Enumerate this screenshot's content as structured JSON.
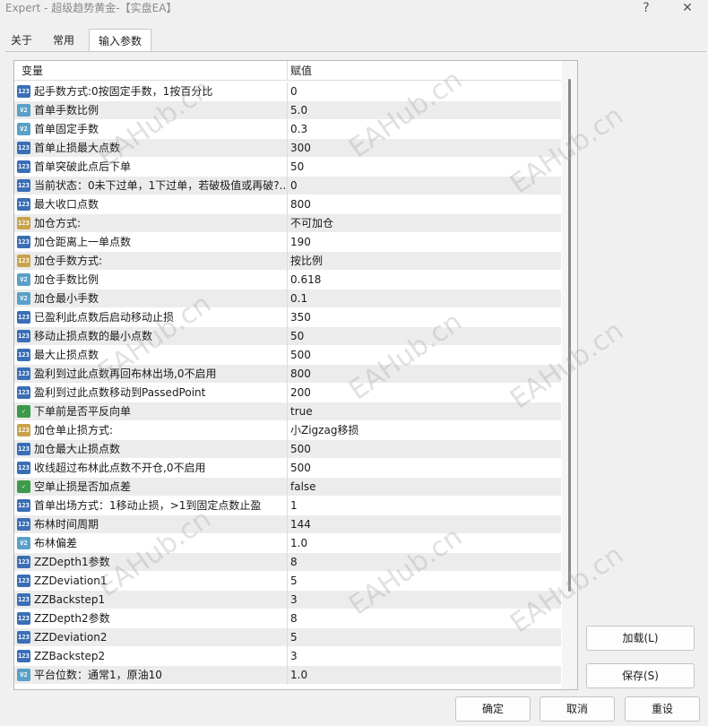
{
  "window": {
    "title": "Expert - 超级趋势黄金-【实盘EA】",
    "help_label": "?",
    "close_label": "✕"
  },
  "tabs": [
    {
      "label": "关于"
    },
    {
      "label": "常用"
    },
    {
      "label": "输入参数"
    }
  ],
  "grid": {
    "col_variable": "变量",
    "col_value": "赋值",
    "rows": [
      {
        "icon": "123",
        "type": "int",
        "name": "起手数方式:0按固定手数，1按百分比",
        "value": "0"
      },
      {
        "icon": "V2",
        "type": "dbl",
        "name": "首单手数比例",
        "value": "5.0"
      },
      {
        "icon": "V2",
        "type": "dbl",
        "name": "首单固定手数",
        "value": "0.3"
      },
      {
        "icon": "123",
        "type": "int",
        "name": "首单止损最大点数",
        "value": "300"
      },
      {
        "icon": "123",
        "type": "int",
        "name": "首单突破此点后下单",
        "value": "50"
      },
      {
        "icon": "123",
        "type": "int",
        "name": "当前状态：0未下过单，1下过单，若破极值或再破?..",
        "value": "0"
      },
      {
        "icon": "123",
        "type": "int",
        "name": "最大收口点数",
        "value": "800"
      },
      {
        "icon": "123",
        "type": "enum",
        "name": "加仓方式:",
        "value": "不可加仓"
      },
      {
        "icon": "123",
        "type": "int",
        "name": "加仓距离上一单点数",
        "value": "190"
      },
      {
        "icon": "123",
        "type": "enum",
        "name": "加仓手数方式:",
        "value": "按比例"
      },
      {
        "icon": "V2",
        "type": "dbl",
        "name": "加仓手数比例",
        "value": "0.618"
      },
      {
        "icon": "V2",
        "type": "dbl",
        "name": "加仓最小手数",
        "value": "0.1"
      },
      {
        "icon": "123",
        "type": "int",
        "name": "已盈利此点数后启动移动止损",
        "value": "350"
      },
      {
        "icon": "123",
        "type": "int",
        "name": "移动止损点数的最小点数",
        "value": "50"
      },
      {
        "icon": "123",
        "type": "int",
        "name": "最大止损点数",
        "value": "500"
      },
      {
        "icon": "123",
        "type": "int",
        "name": "盈利到过此点数再回布林出场,0不启用",
        "value": "800"
      },
      {
        "icon": "123",
        "type": "int",
        "name": "盈利到过此点数移动到PassedPoint",
        "value": "200"
      },
      {
        "icon": "✓",
        "type": "bool",
        "name": "下单前是否平反向单",
        "value": "true"
      },
      {
        "icon": "123",
        "type": "enum",
        "name": "加仓单止损方式:",
        "value": "小Zigzag移损"
      },
      {
        "icon": "123",
        "type": "int",
        "name": "加仓最大止损点数",
        "value": "500"
      },
      {
        "icon": "123",
        "type": "int",
        "name": "收线超过布林此点数不开仓,0不启用",
        "value": "500"
      },
      {
        "icon": "✓",
        "type": "bool",
        "name": "空单止损是否加点差",
        "value": "false"
      },
      {
        "icon": "123",
        "type": "int",
        "name": "首单出场方式：1移动止损，>1到固定点数止盈",
        "value": "1"
      },
      {
        "icon": "123",
        "type": "int",
        "name": "布林时间周期",
        "value": "144"
      },
      {
        "icon": "V2",
        "type": "dbl",
        "name": "布林偏差",
        "value": "1.0"
      },
      {
        "icon": "123",
        "type": "int",
        "name": "ZZDepth1参数",
        "value": "8"
      },
      {
        "icon": "123",
        "type": "int",
        "name": "ZZDeviation1",
        "value": "5"
      },
      {
        "icon": "123",
        "type": "int",
        "name": "ZZBackstep1",
        "value": "3"
      },
      {
        "icon": "123",
        "type": "int",
        "name": "ZZDepth2参数",
        "value": "8"
      },
      {
        "icon": "123",
        "type": "int",
        "name": "ZZDeviation2",
        "value": "5"
      },
      {
        "icon": "123",
        "type": "int",
        "name": "ZZBackstep2",
        "value": "3"
      },
      {
        "icon": "V2",
        "type": "dbl",
        "name": "平台位数：通常1，原油10",
        "value": "1.0"
      }
    ]
  },
  "side_buttons": {
    "load_label": "加载(L)",
    "save_label": "保存(S)"
  },
  "bottom_buttons": {
    "ok_label": "确定",
    "cancel_label": "取消",
    "reset_label": "重设"
  },
  "watermark": "EAHub.cn"
}
